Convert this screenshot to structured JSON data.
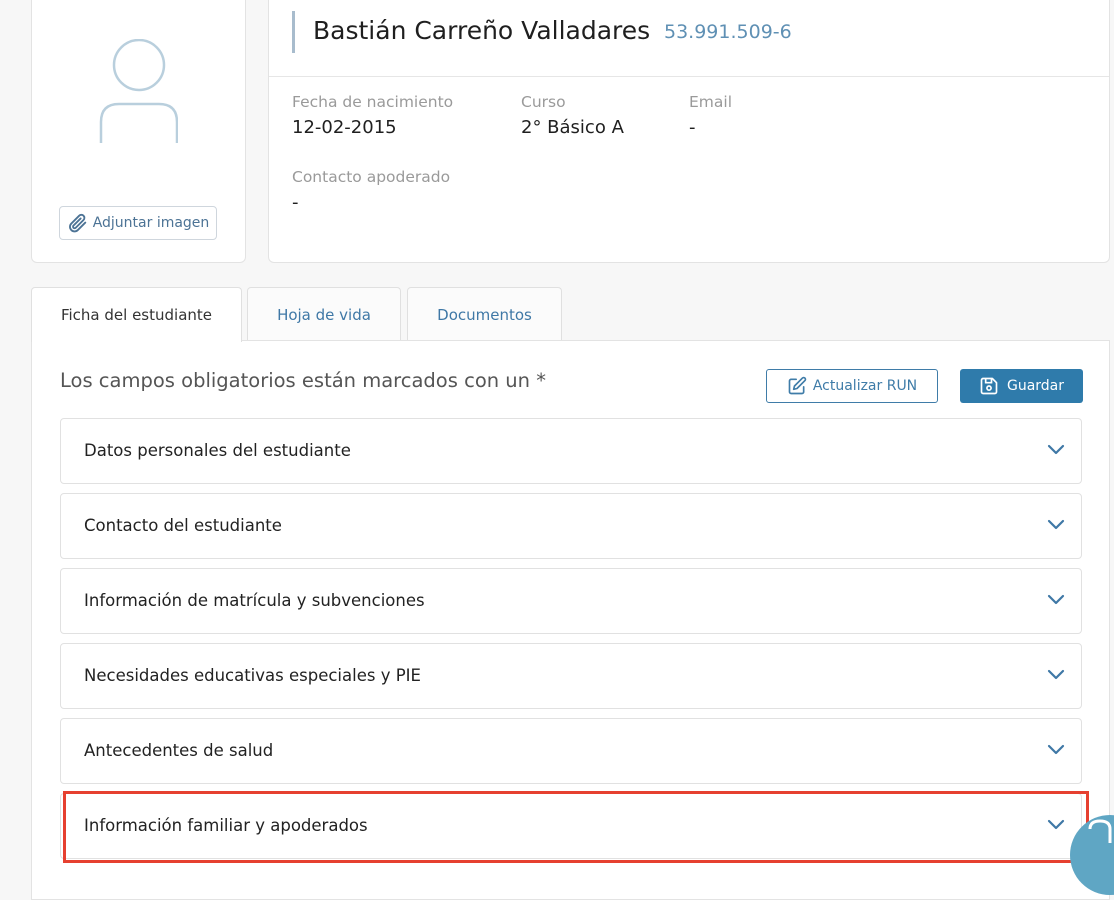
{
  "avatar_card": {
    "attach_label": "Adjuntar imagen"
  },
  "profile": {
    "name": "Bastián Carreño Valladares",
    "run": "53.991.509-6",
    "fields": {
      "birth_label": "Fecha de nacimiento",
      "birth_value": "12-02-2015",
      "course_label": "Curso",
      "course_value": "2° Básico A",
      "email_label": "Email",
      "email_value": "-",
      "contact_label": "Contacto apoderado",
      "contact_value": "-"
    }
  },
  "tabs": [
    {
      "label": "Ficha del estudiante",
      "active": true
    },
    {
      "label": "Hoja de vida",
      "active": false
    },
    {
      "label": "Documentos",
      "active": false
    }
  ],
  "form": {
    "required_note": "Los campos obligatorios están marcados con un *",
    "update_run_label": "Actualizar RUN",
    "save_label": "Guardar"
  },
  "sections": [
    {
      "label": "Datos personales del estudiante"
    },
    {
      "label": "Contacto del estudiante"
    },
    {
      "label": "Información de matrícula y subvenciones"
    },
    {
      "label": "Necesidades educativas especiales y PIE"
    },
    {
      "label": "Antecedentes de salud"
    },
    {
      "label": "Información familiar y apoderados"
    }
  ],
  "colors": {
    "accent": "#2f7bab",
    "link": "#3f78a6",
    "highlight": "#e64030",
    "run_text": "#5f90b4"
  }
}
